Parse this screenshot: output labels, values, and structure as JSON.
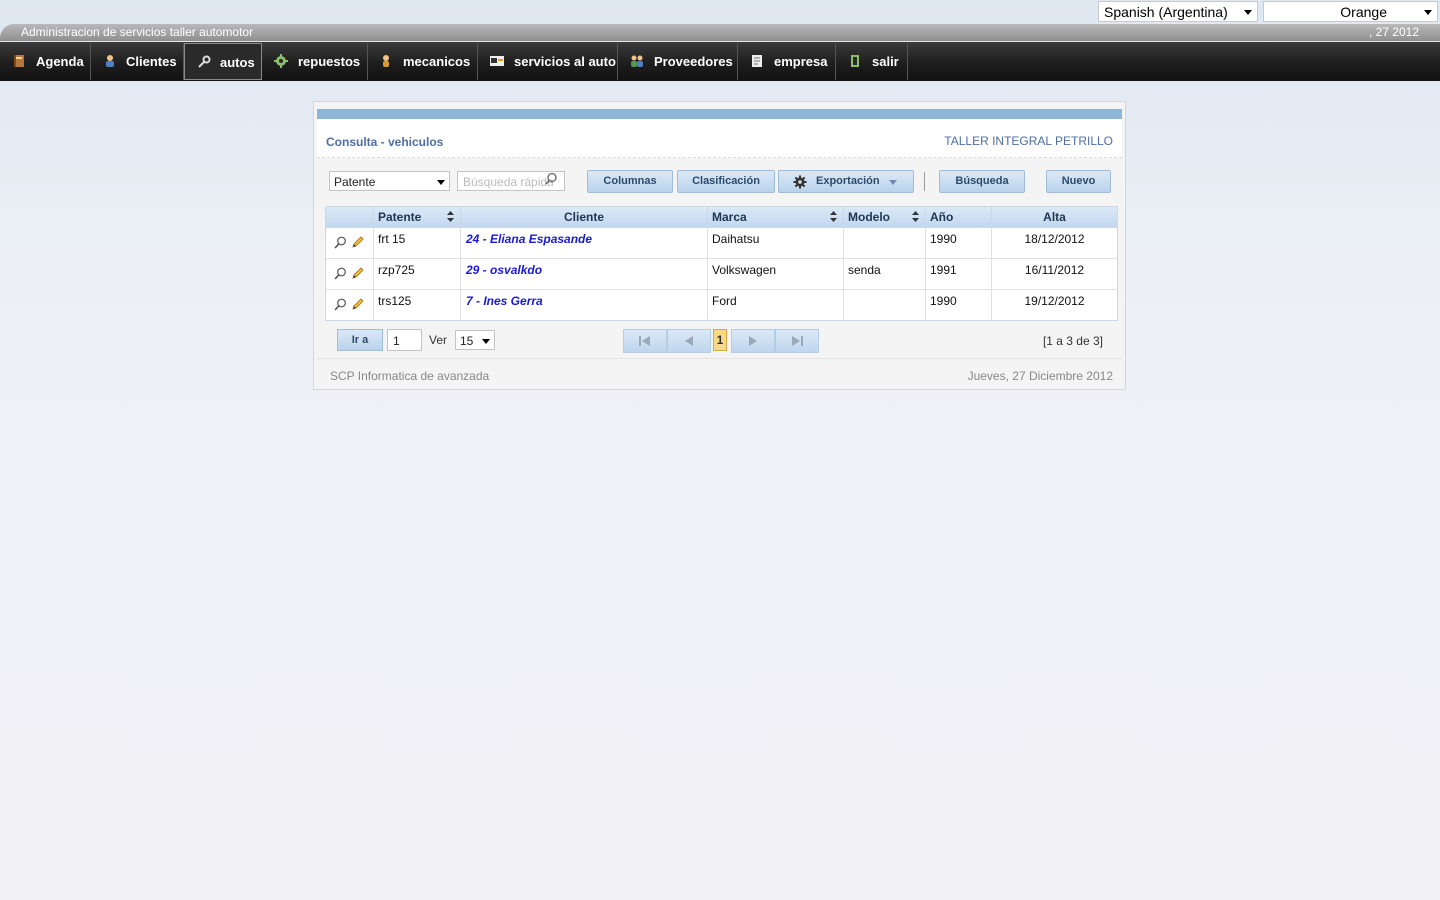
{
  "top": {
    "language": "Spanish (Argentina)",
    "theme": "Orange"
  },
  "header": {
    "app_title": "Administracion de servicios taller automotor",
    "short_date": ", 27 2012"
  },
  "nav": [
    {
      "label": "Agenda",
      "icon": "book-icon"
    },
    {
      "label": "Clientes",
      "icon": "person-icon"
    },
    {
      "label": "autos",
      "icon": "wrench-icon"
    },
    {
      "label": "repuestos",
      "icon": "gear-icon"
    },
    {
      "label": "mecanicos",
      "icon": "mechanic-icon"
    },
    {
      "label": "servicios al auto",
      "icon": "card-icon"
    },
    {
      "label": "Proveedores",
      "icon": "people-icon"
    },
    {
      "label": "empresa",
      "icon": "document-icon"
    },
    {
      "label": "salir",
      "icon": "exit-icon"
    }
  ],
  "panel": {
    "title": "Consulta - vehiculos",
    "company": "TALLER INTEGRAL PETRILLO",
    "search_field": "Patente",
    "quick_search_placeholder": "Búsqueda rápida",
    "buttons": {
      "columnas": "Columnas",
      "clasificacion": "Clasificación",
      "exportacion": "Exportación",
      "busqueda": "Búsqueda",
      "nuevo": "Nuevo"
    },
    "columns": [
      "Patente",
      "Cliente",
      "Marca",
      "Modelo",
      "Año",
      "Alta"
    ],
    "rows": [
      {
        "patente": "frt 15",
        "cliente": "24 - Eliana Espasande",
        "marca": "Daihatsu",
        "modelo": "",
        "anio": "1990",
        "alta": "18/12/2012"
      },
      {
        "patente": "rzp725",
        "cliente": "29 - osvalkdo",
        "marca": "Volkswagen",
        "modelo": "senda",
        "anio": "1991",
        "alta": "16/11/2012"
      },
      {
        "patente": "trs125",
        "cliente": "7 - Ines Gerra",
        "marca": "Ford",
        "modelo": "",
        "anio": "1990",
        "alta": "19/12/2012"
      }
    ],
    "pager": {
      "goto_label": "Ir a",
      "page_value": "1",
      "ver_label": "Ver",
      "per_page": "15",
      "current_page": "1",
      "info": "[1 a 3 de 3]"
    },
    "footer_left": "SCP Informatica de avanzada",
    "footer_right": "Jueves, 27 Diciembre 2012"
  },
  "colors": {
    "accent_link": "#1a1ad0",
    "title_blue": "#4f6fa3",
    "header_bar": "#8fb6d6",
    "current_page": "#f8d987"
  }
}
